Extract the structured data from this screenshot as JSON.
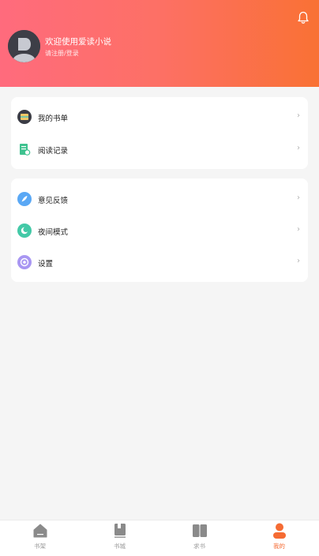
{
  "header": {
    "title": "欢迎使用爱读小说",
    "subtitle": "请注册/登录",
    "bell_icon": "bell-icon",
    "avatar_icon": "avatar-icon"
  },
  "menu_groups": [
    {
      "items": [
        {
          "label": "我的书单",
          "icon": "book-list-icon",
          "chevron": "›"
        },
        {
          "label": "阅读记录",
          "icon": "reading-record-icon",
          "chevron": "›"
        }
      ]
    },
    {
      "items": [
        {
          "label": "意见反馈",
          "icon": "feedback-icon",
          "chevron": "›"
        },
        {
          "label": "夜间模式",
          "icon": "night-mode-icon",
          "chevron": "›"
        },
        {
          "label": "设置",
          "icon": "settings-icon",
          "chevron": "›"
        }
      ]
    }
  ],
  "tabs": [
    {
      "label": "书架",
      "icon": "bookshelf-icon"
    },
    {
      "label": "书城",
      "icon": "bookstore-icon"
    },
    {
      "label": "求书",
      "icon": "request-book-icon"
    },
    {
      "label": "我的",
      "icon": "profile-icon",
      "active": true
    }
  ],
  "colors": {
    "header_gradient_start": "#ff6b7d",
    "header_gradient_end": "#f97134",
    "accent": "#f56b33",
    "inactive_tab": "#999999"
  }
}
